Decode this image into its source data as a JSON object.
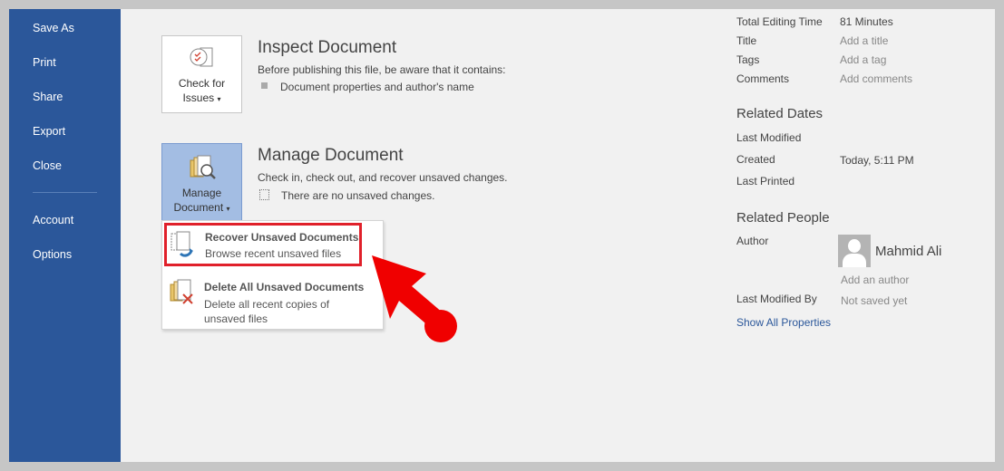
{
  "sidebar": {
    "items": [
      {
        "label": "Save As"
      },
      {
        "label": "Print"
      },
      {
        "label": "Share"
      },
      {
        "label": "Export"
      },
      {
        "label": "Close"
      },
      {
        "label": "Account"
      },
      {
        "label": "Options"
      }
    ]
  },
  "inspect": {
    "button_line1": "Check for",
    "button_line2": "Issues",
    "title": "Inspect Document",
    "desc": "Before publishing this file, be aware that it contains:",
    "bullet": "Document properties and author's name"
  },
  "manage": {
    "button_line1": "Manage",
    "button_line2": "Document",
    "title": "Manage Document",
    "desc": "Check in, check out, and recover unsaved changes.",
    "status": "There are no unsaved changes."
  },
  "menu": {
    "items": [
      {
        "title": "Recover Unsaved Documents",
        "desc": "Browse recent unsaved files"
      },
      {
        "title": "Delete All Unsaved Documents",
        "desc1": "Delete all recent copies of",
        "desc2": "unsaved files"
      }
    ]
  },
  "properties": {
    "rows": [
      {
        "label": "Total Editing Time",
        "value": "81 Minutes"
      },
      {
        "label": "Title",
        "value": "Add a title"
      },
      {
        "label": "Tags",
        "value": "Add a tag"
      },
      {
        "label": "Comments",
        "value": "Add comments"
      }
    ],
    "related_dates": {
      "heading": "Related Dates",
      "last_modified": "Last Modified",
      "created": "Created",
      "created_value": "Today, 5:11 PM",
      "last_printed": "Last Printed"
    },
    "related_people": {
      "heading": "Related People",
      "author": "Author",
      "author_name": "Mahmid Ali",
      "add_author": "Add an author",
      "last_modified_by": "Last Modified By",
      "last_modified_by_value": "Not saved yet"
    },
    "show_all": "Show All Properties"
  },
  "colors": {
    "sidebar": "#2b579a",
    "highlight": "#e0202a",
    "link": "#2b579a"
  }
}
